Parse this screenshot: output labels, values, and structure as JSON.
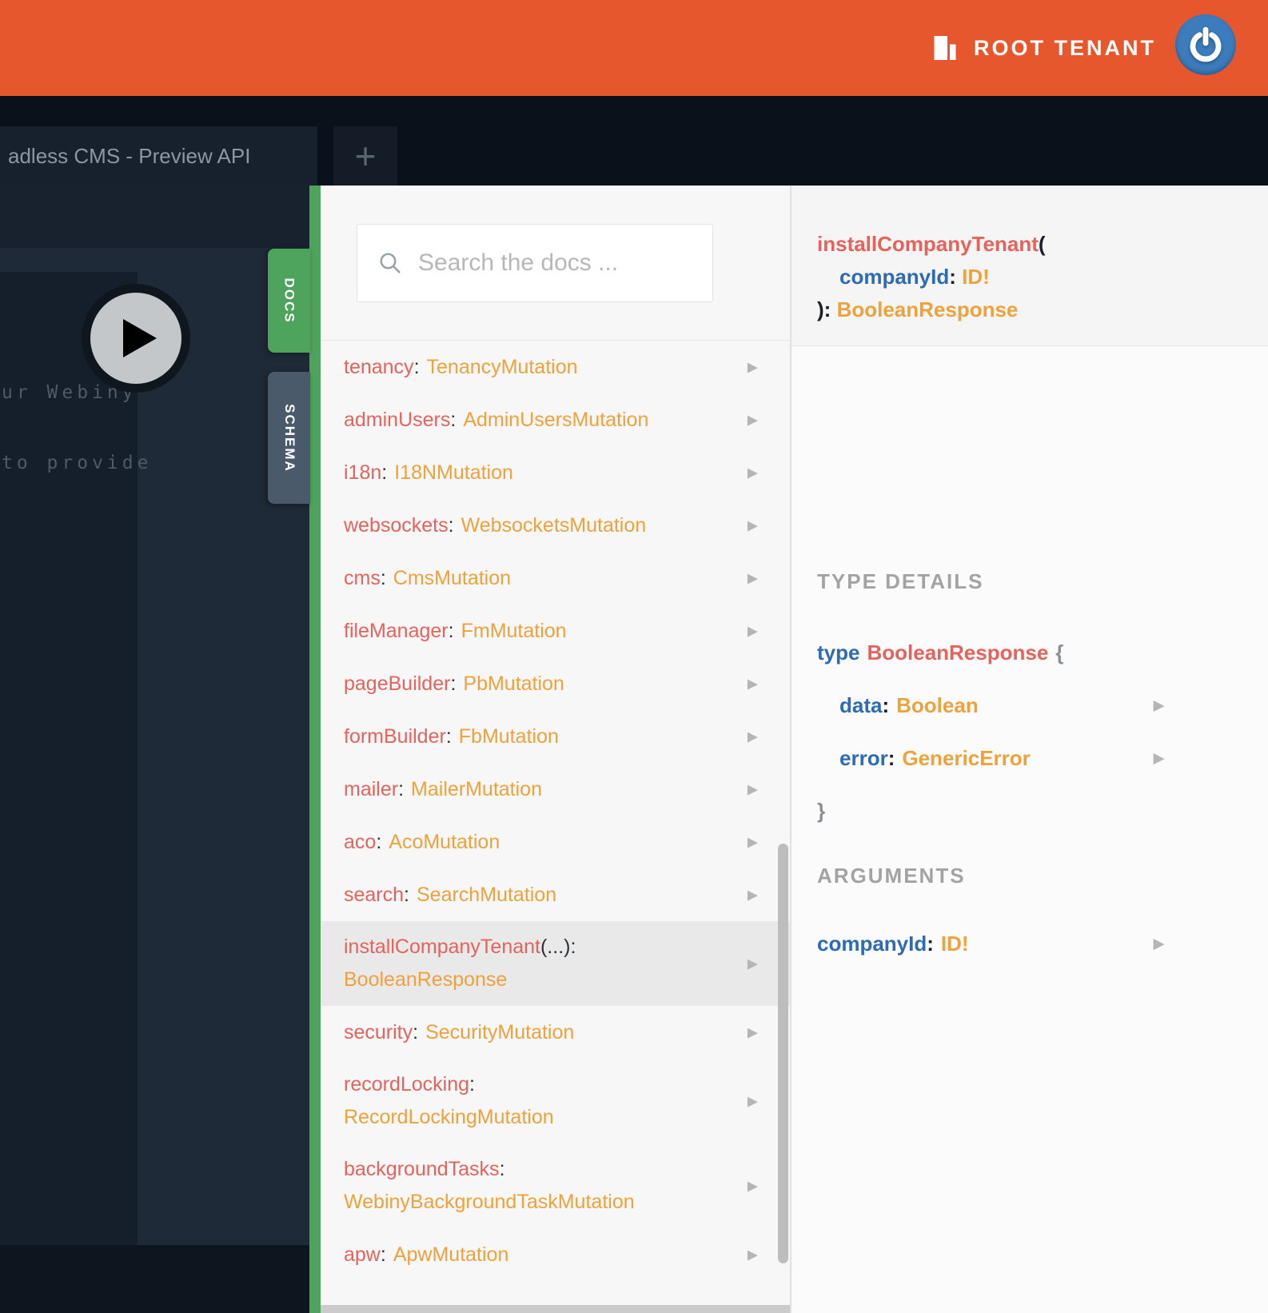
{
  "header": {
    "tenant_label": "ROOT TENANT"
  },
  "tabbar": {
    "active_tab_label": "adless CMS - Preview API",
    "new_tab_label": "+"
  },
  "side_tabs": {
    "docs_label": "DOCS",
    "schema_label": "SCHEMA"
  },
  "editor": {
    "line1": "ur Webiny",
    "line2": "to provide"
  },
  "docs": {
    "search_placeholder": "Search the docs ...",
    "items": [
      {
        "field": "tenancy",
        "suffix": ":",
        "type": "TenancyMutation",
        "wrap": false,
        "highlight": false
      },
      {
        "field": "adminUsers",
        "suffix": ":",
        "type": "AdminUsersMutation",
        "wrap": false,
        "highlight": false
      },
      {
        "field": "i18n",
        "suffix": ":",
        "type": "I18NMutation",
        "wrap": false,
        "highlight": false
      },
      {
        "field": "websockets",
        "suffix": ":",
        "type": "WebsocketsMutation",
        "wrap": false,
        "highlight": false
      },
      {
        "field": "cms",
        "suffix": ":",
        "type": "CmsMutation",
        "wrap": false,
        "highlight": false
      },
      {
        "field": "fileManager",
        "suffix": ":",
        "type": "FmMutation",
        "wrap": false,
        "highlight": false
      },
      {
        "field": "pageBuilder",
        "suffix": ":",
        "type": "PbMutation",
        "wrap": false,
        "highlight": false
      },
      {
        "field": "formBuilder",
        "suffix": ":",
        "type": "FbMutation",
        "wrap": false,
        "highlight": false
      },
      {
        "field": "mailer",
        "suffix": ":",
        "type": "MailerMutation",
        "wrap": false,
        "highlight": false
      },
      {
        "field": "aco",
        "suffix": ":",
        "type": "AcoMutation",
        "wrap": false,
        "highlight": false
      },
      {
        "field": "search",
        "suffix": ":",
        "type": "SearchMutation",
        "wrap": false,
        "highlight": false
      },
      {
        "field": "installCompanyTenant",
        "suffix": "(...):",
        "type": "BooleanResponse",
        "wrap": true,
        "highlight": true
      },
      {
        "field": "security",
        "suffix": ":",
        "type": "SecurityMutation",
        "wrap": false,
        "highlight": false
      },
      {
        "field": "recordLocking",
        "suffix": ":",
        "type": "RecordLockingMutation",
        "wrap": true,
        "highlight": false
      },
      {
        "field": "backgroundTasks",
        "suffix": ":",
        "type": "WebinyBackgroundTaskMutation",
        "wrap": true,
        "highlight": false
      },
      {
        "field": "apw",
        "suffix": ":",
        "type": "ApwMutation",
        "wrap": false,
        "highlight": false
      }
    ]
  },
  "detail": {
    "punct": {
      "colon": ":"
    },
    "signature": {
      "name": "installCompanyTenant",
      "open_paren": "(",
      "arg_name": "companyId",
      "arg_type": "ID!",
      "close": "):",
      "return_type": "BooleanResponse"
    },
    "type_details": {
      "heading": "TYPE DETAILS",
      "keyword": "type",
      "type_name": "BooleanResponse",
      "open_brace": "{",
      "fields": [
        {
          "name": "data",
          "type": "Boolean"
        },
        {
          "name": "error",
          "type": "GenericError"
        }
      ],
      "close_brace": "}"
    },
    "arguments": {
      "heading": "ARGUMENTS",
      "items": [
        {
          "name": "companyId",
          "type": "ID!"
        }
      ]
    }
  },
  "colors": {
    "header_orange": "#e7572e",
    "docs_green": "#4fa45d",
    "schema_slate": "#4a5a6b",
    "field_salmon": "#e4635c",
    "type_orange": "#efa13c",
    "keyword_blue": "#2d6bb2",
    "highlight_row": "#e9e9e9",
    "avatar_blue": "#3c7cbc"
  }
}
